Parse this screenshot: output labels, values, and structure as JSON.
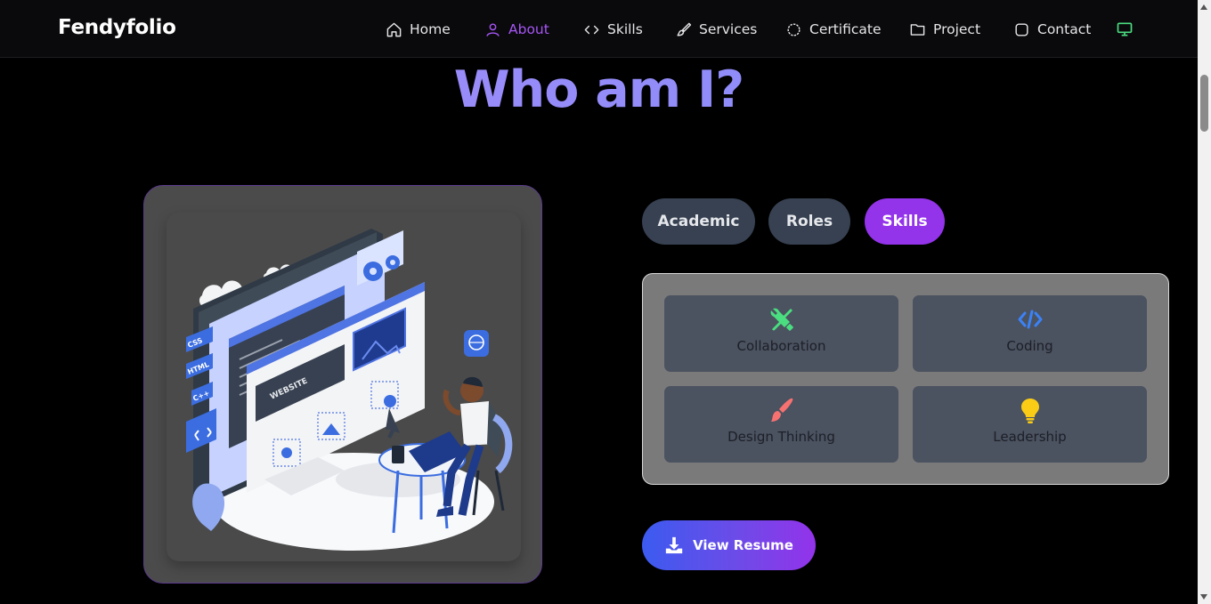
{
  "brand": "Fendyfolio",
  "nav": {
    "items": [
      {
        "label": "Home",
        "icon": "home-icon"
      },
      {
        "label": "About",
        "icon": "user-icon",
        "active": true
      },
      {
        "label": "Skills",
        "icon": "code-icon"
      },
      {
        "label": "Services",
        "icon": "brush-icon"
      },
      {
        "label": "Certificate",
        "icon": "badge-icon"
      },
      {
        "label": "Project",
        "icon": "folder-icon"
      },
      {
        "label": "Contact",
        "icon": "chat-icon"
      }
    ],
    "theme_toggle_icon": "monitor-icon"
  },
  "section": {
    "title": "Who am I?"
  },
  "tabs": [
    {
      "label": "Academic",
      "active": false
    },
    {
      "label": "Roles",
      "active": false
    },
    {
      "label": "Skills",
      "active": true
    }
  ],
  "skills": [
    {
      "label": "Collaboration",
      "icon": "tools-icon",
      "color": "#4ade80"
    },
    {
      "label": "Coding",
      "icon": "code-icon",
      "color": "#3b82f6"
    },
    {
      "label": "Design Thinking",
      "icon": "paintbrush-icon",
      "color": "#f87171"
    },
    {
      "label": "Leadership",
      "icon": "lightbulb-icon",
      "color": "#facc15"
    }
  ],
  "illustration": {
    "browser_label": "WEBSITE",
    "tags": [
      "CSS",
      "HTML",
      "C++"
    ]
  },
  "resume_button": {
    "label": "View Resume",
    "icon": "download-icon"
  },
  "colors": {
    "accent": "#9333ea",
    "title": "#8b8bf5",
    "nav_active": "#a855f7",
    "tab_inactive": "#374151"
  }
}
